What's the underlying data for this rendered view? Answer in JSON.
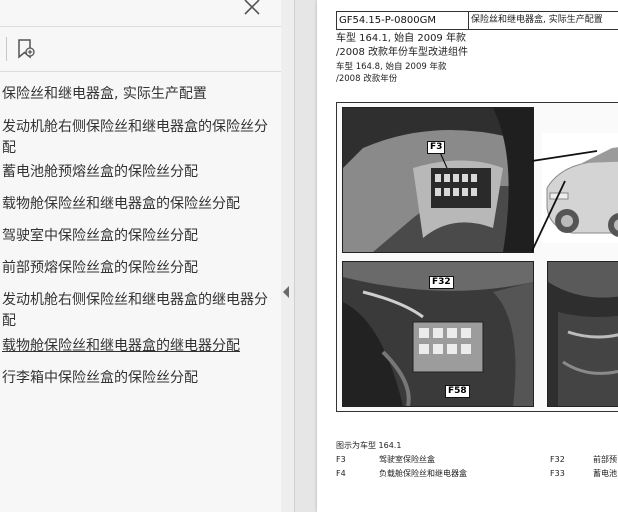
{
  "sidebar": {
    "items": [
      {
        "label": "保险丝和继电器盒, 实际生产配置"
      },
      {
        "label": "发动机舱右侧保险丝和继电器盒的保险丝分配"
      },
      {
        "label": "蓄电池舱预熔丝盒的保险丝分配"
      },
      {
        "label": "载物舱保险丝和继电器盒的保险丝分配"
      },
      {
        "label": "驾驶室中保险丝盒的保险丝分配"
      },
      {
        "label": "前部预熔保险丝盒的保险丝分配"
      },
      {
        "label": "发动机舱右侧保险丝和继电器盒的继电器分配"
      },
      {
        "label": "载物舱保险丝和继电器盒的继电器分配"
      },
      {
        "label": "行李箱中保险丝盒的保险丝分配"
      }
    ],
    "active_index": 7
  },
  "icons": {
    "close": "close-icon",
    "bookmark": "bookmark-options-icon",
    "collapse": "collapse-left-arrow-icon"
  },
  "document": {
    "header": {
      "code": "GF54.15-P-0800GM",
      "title": "保险丝和继电器盒, 实际生产配置"
    },
    "model_lines": [
      {
        "text": "车型   164.1, 始自 2009 年款",
        "size": "lg"
      },
      {
        "text": "/2008 改款年份车型改进组件",
        "size": "lg"
      },
      {
        "text": "车型   164.8, 始自 2009 年款",
        "size": "sm"
      },
      {
        "text": "          /2008 改款年份",
        "size": "sm"
      }
    ],
    "callouts": {
      "f3": "F3",
      "f32": "F32",
      "f58": "F58"
    },
    "caption": {
      "title": "图示为车型 164.1",
      "rows": [
        {
          "code": "F3",
          "desc": "驾驶室保险丝盒",
          "code2": "F32",
          "desc2": "前部预"
        },
        {
          "code": "F4",
          "desc": "负载舱保险丝和继电器盒",
          "code2": "F33",
          "desc2": "蓄电池"
        }
      ]
    }
  }
}
